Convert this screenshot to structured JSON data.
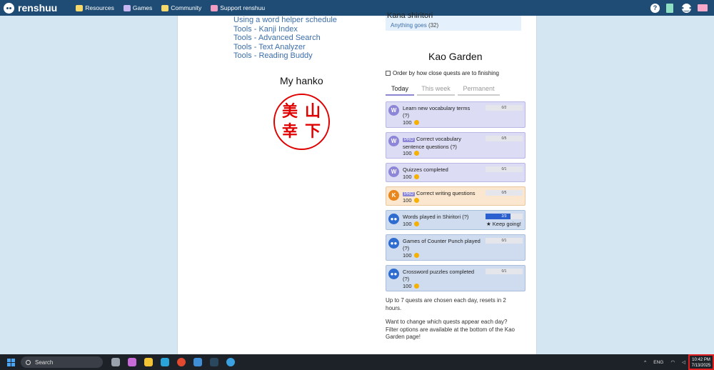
{
  "topbar": {
    "logo": "renshuu",
    "nav": [
      {
        "label": "Resources",
        "icon": "book-icon",
        "color": "#f5d96b"
      },
      {
        "label": "Games",
        "icon": "dice-icon",
        "color": "#c8b6f2"
      },
      {
        "label": "Community",
        "icon": "chat-icon",
        "color": "#f5d96b"
      },
      {
        "label": "Support renshuu",
        "icon": "gift-icon",
        "color": "#f29cc2"
      }
    ],
    "help": "?"
  },
  "links": [
    "Using a word helper schedule",
    "Tools - Kanji Index",
    "Tools - Advanced Search",
    "Tools - Text Analyzer",
    "Tools - Reading Buddy"
  ],
  "hanko": {
    "title": "My hanko",
    "chars": [
      "美",
      "山",
      "幸",
      "下"
    ]
  },
  "shiritori": {
    "title": "Kana shiritori",
    "sub": "Anything goes",
    "count": "(32)"
  },
  "kao": {
    "title": "Kao Garden",
    "order_label": "Order by how close quests are to finishing",
    "tabs": [
      "Today",
      "This week",
      "Permanent"
    ],
    "quests": [
      {
        "icon": "W",
        "pro": "",
        "text": "Learn new vocabulary terms",
        "help": "(?)",
        "points": "100",
        "progress": "0/2",
        "pct": 0
      },
      {
        "icon": "W",
        "pro": "PRO",
        "text": "Correct vocabulary sentence questions",
        "help": "(?)",
        "points": "100",
        "progress": "0/5",
        "pct": 0
      },
      {
        "icon": "W",
        "pro": "",
        "text": "Quizzes completed",
        "help": "",
        "points": "100",
        "progress": "0/1",
        "pct": 0
      },
      {
        "icon": "K",
        "pro": "PRO",
        "text": "Correct writing questions",
        "help": "",
        "points": "100",
        "progress": "0/5",
        "pct": 0
      },
      {
        "icon": "chat",
        "pro": "",
        "text": "Words played in Shiritori",
        "help": "(?)",
        "points": "100",
        "progress": "2/3",
        "pct": 0.67,
        "note": "★ Keep going!"
      },
      {
        "icon": "chat",
        "pro": "",
        "text": "Games of Counter Punch played",
        "help": "(?)",
        "points": "100",
        "progress": "0/1",
        "pct": 0
      },
      {
        "icon": "chat",
        "pro": "",
        "text": "Crossword puzzles completed",
        "help": "(?)",
        "points": "100",
        "progress": "0/1",
        "pct": 0
      }
    ],
    "footer1": "Up to 7 quests are chosen each day, resets in 2 hours.",
    "footer2": "Want to change which quests appear each day? Filter options are available at the bottom of the Kao Garden page!"
  },
  "taskbar": {
    "search": "Search",
    "lang": "ENG",
    "time": "10:42 PM",
    "date": "7/13/2025"
  }
}
